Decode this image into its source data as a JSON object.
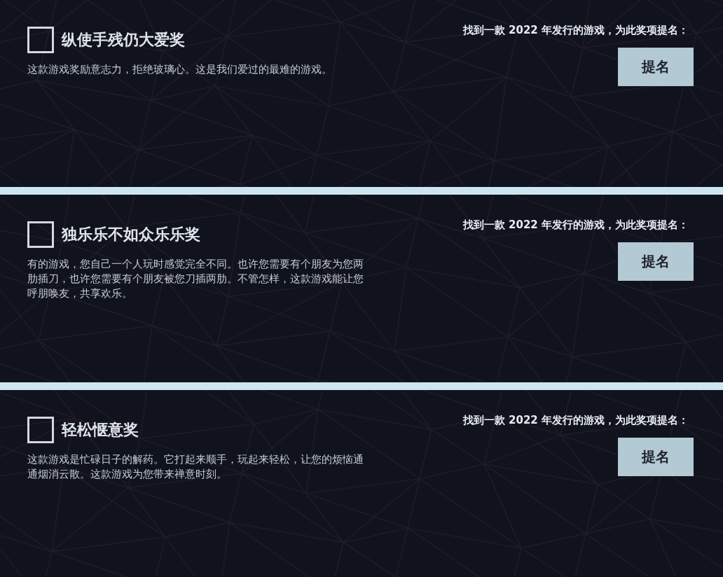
{
  "awards": [
    {
      "checked": false,
      "title": "纵使手残仍大爱奖",
      "description": "这款游戏奖励意志力，拒绝玻璃心。这是我们爱过的最难的游戏。",
      "prompt": "找到一款 2022 年发行的游戏，为此奖项提名：",
      "button": "提名"
    },
    {
      "checked": false,
      "title": "独乐乐不如众乐乐奖",
      "description": "有的游戏，您自己一个人玩时感觉完全不同。也许您需要有个朋友为您两肋插刀，也许您需要有个朋友被您刀插两肋。不管怎样，这款游戏能让您呼朋唤友，共享欢乐。",
      "prompt": "找到一款 2022 年发行的游戏，为此奖项提名：",
      "button": "提名"
    },
    {
      "checked": false,
      "title": "轻松惬意奖",
      "description": "这款游戏是忙碌日子的解药。它打起来顺手，玩起来轻松，让您的烦恼通通烟消云散。这款游戏为您带来禅意时刻。",
      "prompt": "找到一款 2022 年发行的游戏，为此奖项提名：",
      "button": "提名"
    }
  ]
}
